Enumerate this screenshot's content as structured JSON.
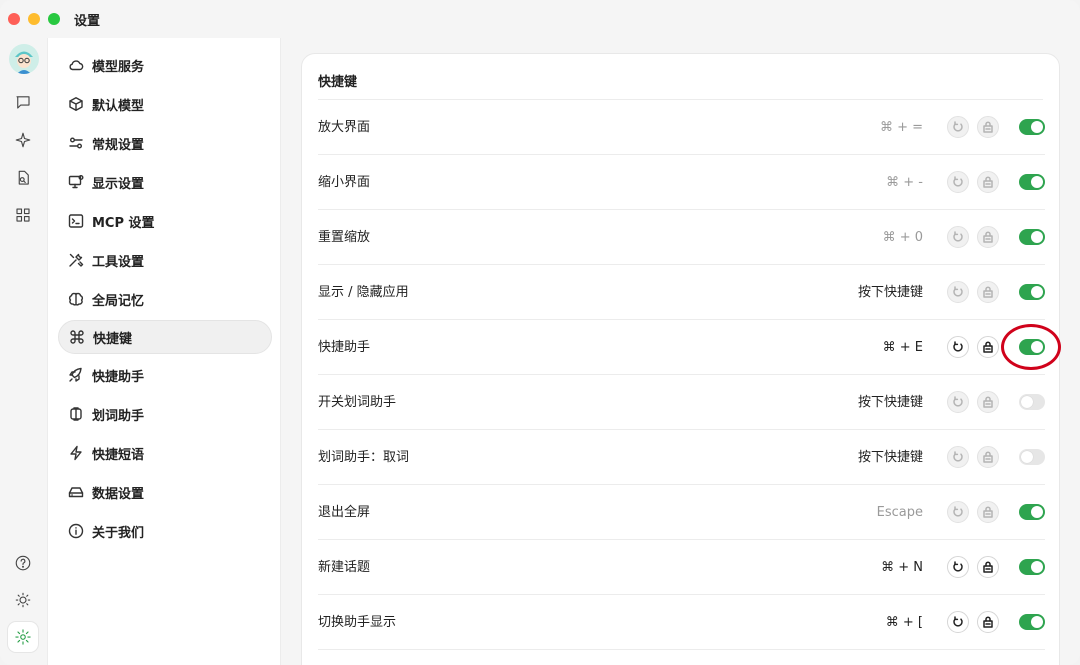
{
  "window": {
    "title": "设置"
  },
  "rail": {
    "items": [
      {
        "icon": "chat-icon"
      },
      {
        "icon": "sparkle-icon"
      },
      {
        "icon": "document-search-icon"
      },
      {
        "icon": "apps-grid-icon"
      }
    ],
    "bottom": [
      {
        "icon": "help-icon"
      },
      {
        "icon": "sun-icon"
      },
      {
        "icon": "settings-gear-icon",
        "active": true
      }
    ]
  },
  "sidebar": {
    "items": [
      {
        "label": "模型服务",
        "icon": "cloud-icon"
      },
      {
        "label": "默认模型",
        "icon": "cube-icon"
      },
      {
        "label": "常规设置",
        "icon": "sliders-icon"
      },
      {
        "label": "显示设置",
        "icon": "monitor-icon"
      },
      {
        "label": "MCP 设置",
        "icon": "terminal-icon"
      },
      {
        "label": "工具设置",
        "icon": "tools-icon"
      },
      {
        "label": "全局记忆",
        "icon": "brain-icon"
      },
      {
        "label": "快捷键",
        "icon": "command-icon",
        "active": true
      },
      {
        "label": "快捷助手",
        "icon": "rocket-icon"
      },
      {
        "label": "划词助手",
        "icon": "text-cursor-icon"
      },
      {
        "label": "快捷短语",
        "icon": "bolt-icon"
      },
      {
        "label": "数据设置",
        "icon": "drive-icon"
      },
      {
        "label": "关于我们",
        "icon": "info-icon"
      }
    ]
  },
  "main": {
    "section_title": "快捷键",
    "shortcuts": [
      {
        "label": "放大界面",
        "key": "⌘ + =",
        "key_dim": true,
        "buttons_enabled": false,
        "enabled": true
      },
      {
        "label": "缩小界面",
        "key": "⌘ + -",
        "key_dim": true,
        "buttons_enabled": false,
        "enabled": true
      },
      {
        "label": "重置缩放",
        "key": "⌘ + 0",
        "key_dim": true,
        "buttons_enabled": false,
        "enabled": true
      },
      {
        "label": "显示 / 隐藏应用",
        "key": "按下快捷键",
        "key_dim": false,
        "buttons_enabled": false,
        "enabled": true
      },
      {
        "label": "快捷助手",
        "key": "⌘ + E",
        "key_dim": false,
        "buttons_enabled": true,
        "enabled": true,
        "highlighted": true
      },
      {
        "label": "开关划词助手",
        "key": "按下快捷键",
        "key_dim": false,
        "buttons_enabled": false,
        "enabled": false
      },
      {
        "label": "划词助手：取词",
        "key": "按下快捷键",
        "key_dim": false,
        "buttons_enabled": false,
        "enabled": false
      },
      {
        "label": "退出全屏",
        "key": "Escape",
        "key_dim": true,
        "buttons_enabled": false,
        "enabled": true
      },
      {
        "label": "新建话题",
        "key": "⌘ + N",
        "key_dim": false,
        "buttons_enabled": true,
        "enabled": true
      },
      {
        "label": "切换助手显示",
        "key": "⌘ + [",
        "key_dim": false,
        "buttons_enabled": true,
        "enabled": true
      }
    ]
  },
  "colors": {
    "toggle_on": "#2ea44f",
    "toggle_off": "#e6e6e6",
    "highlight_ring": "#d0021b"
  }
}
